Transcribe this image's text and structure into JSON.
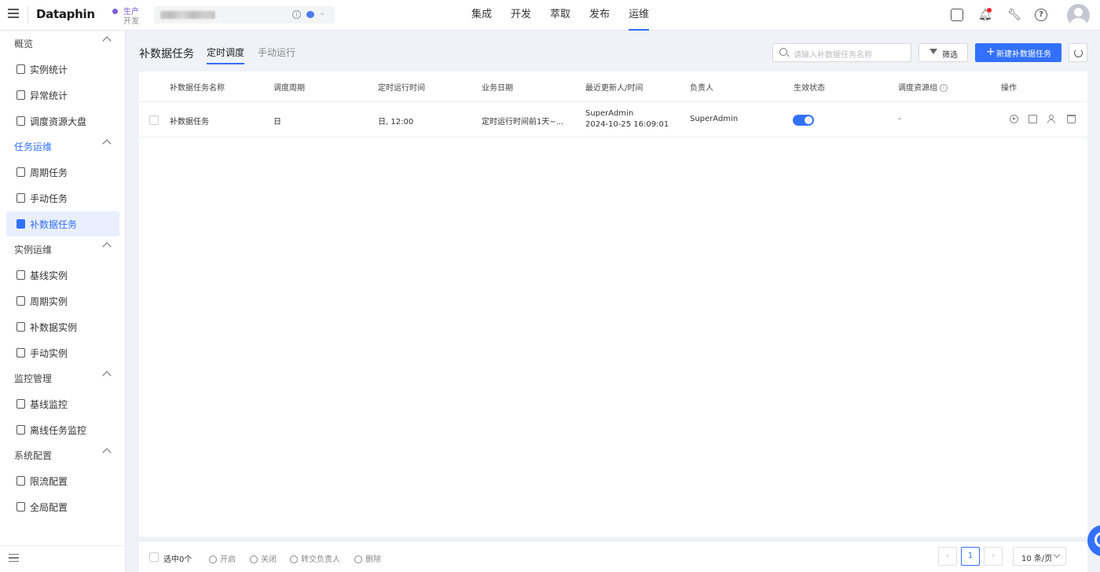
{
  "brand": "Dataphin",
  "env": {
    "line1": "生产",
    "line2": "开发"
  },
  "nav": [
    "集成",
    "开发",
    "萃取",
    "发布",
    "运维"
  ],
  "nav_active": "运维",
  "sidebar": {
    "groups": [
      {
        "label": "概览",
        "items": [
          "实例统计",
          "异常统计",
          "调度资源大盘"
        ]
      },
      {
        "label": "任务运维",
        "items": [
          "周期任务",
          "手动任务",
          "补数据任务"
        ]
      },
      {
        "label": "实例运维",
        "items": [
          "基线实例",
          "周期实例",
          "补数据实例",
          "手动实例"
        ]
      },
      {
        "label": "监控管理",
        "items": [
          "基线监控",
          "离线任务监控"
        ]
      },
      {
        "label": "系统配置",
        "items": [
          "限流配置",
          "全局配置"
        ]
      }
    ],
    "active_item": "补数据任务"
  },
  "page": {
    "title": "补数据任务",
    "tabs": [
      "定时调度",
      "手动运行"
    ],
    "active_tab": "定时调度",
    "search_placeholder": "请输入补数据任务名称",
    "filter_label": "筛选",
    "new_button": "新建补数据任务"
  },
  "table": {
    "columns": [
      "补数据任务名称",
      "调度周期",
      "定时运行时间",
      "业务日期",
      "最近更新人/时间",
      "负责人",
      "生效状态",
      "调度资源组",
      "操作"
    ],
    "rows": [
      {
        "name": "补数据任务",
        "cycle": "日",
        "run_time": "日, 12:00",
        "biz_date": "定时运行时间前1天~...",
        "updater": "SuperAdmin",
        "updated_at": "2024-10-25 16:09:01",
        "owner": "SuperAdmin",
        "enabled": true,
        "resource_group": "-"
      }
    ]
  },
  "footer": {
    "selected": "选中0个",
    "actions": [
      "开启",
      "关闭",
      "转交负责人",
      "删除"
    ],
    "page": "1",
    "page_size": "10 条/页"
  },
  "colors": {
    "accent": "#3370ff",
    "env_purple": "#7b5cd6"
  }
}
